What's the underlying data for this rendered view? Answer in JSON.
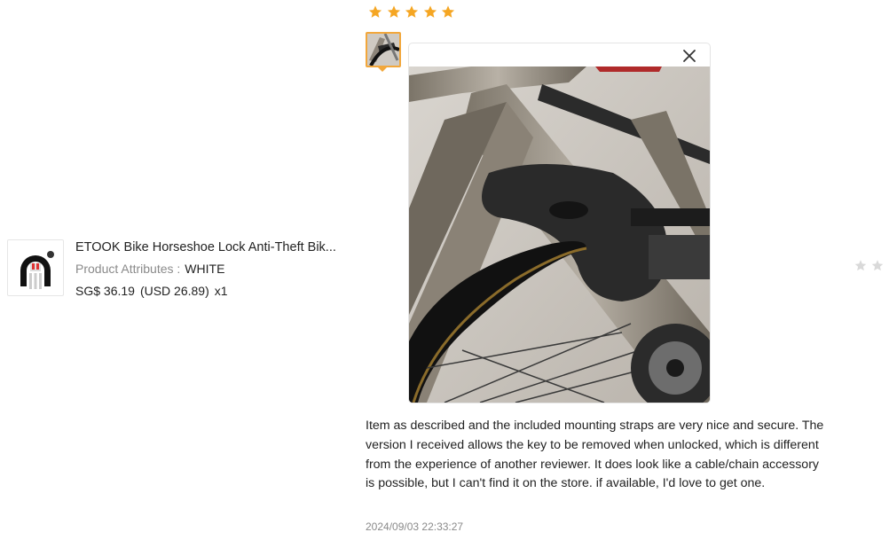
{
  "product": {
    "title": "ETOOK Bike Horseshoe Lock Anti-Theft Bik...",
    "attributes_label": "Product Attributes :",
    "attributes_value": "WHITE",
    "price_local": "SG$ 36.19",
    "price_usd": "(USD  26.89)",
    "quantity": "x1",
    "thumbnail_icon": "horseshoe-lock-icon"
  },
  "review": {
    "rating": 5,
    "max_rating": 5,
    "star_color": "#f5a623",
    "text": "Item as described and the included mounting straps are very nice and secure. The version I received allows the key to be removed when unlocked, which is different from the experience of another reviewer. It does look like a cable/chain accessory is possible, but I can't find it on the store. if available, I'd love to get one.",
    "date": "2024/09/03 22:33:27",
    "selected_thumb_border": "#f2a73b"
  },
  "preview": {
    "close_icon": "close-icon"
  },
  "side_rating": {
    "star_color": "#d9d9d9"
  }
}
